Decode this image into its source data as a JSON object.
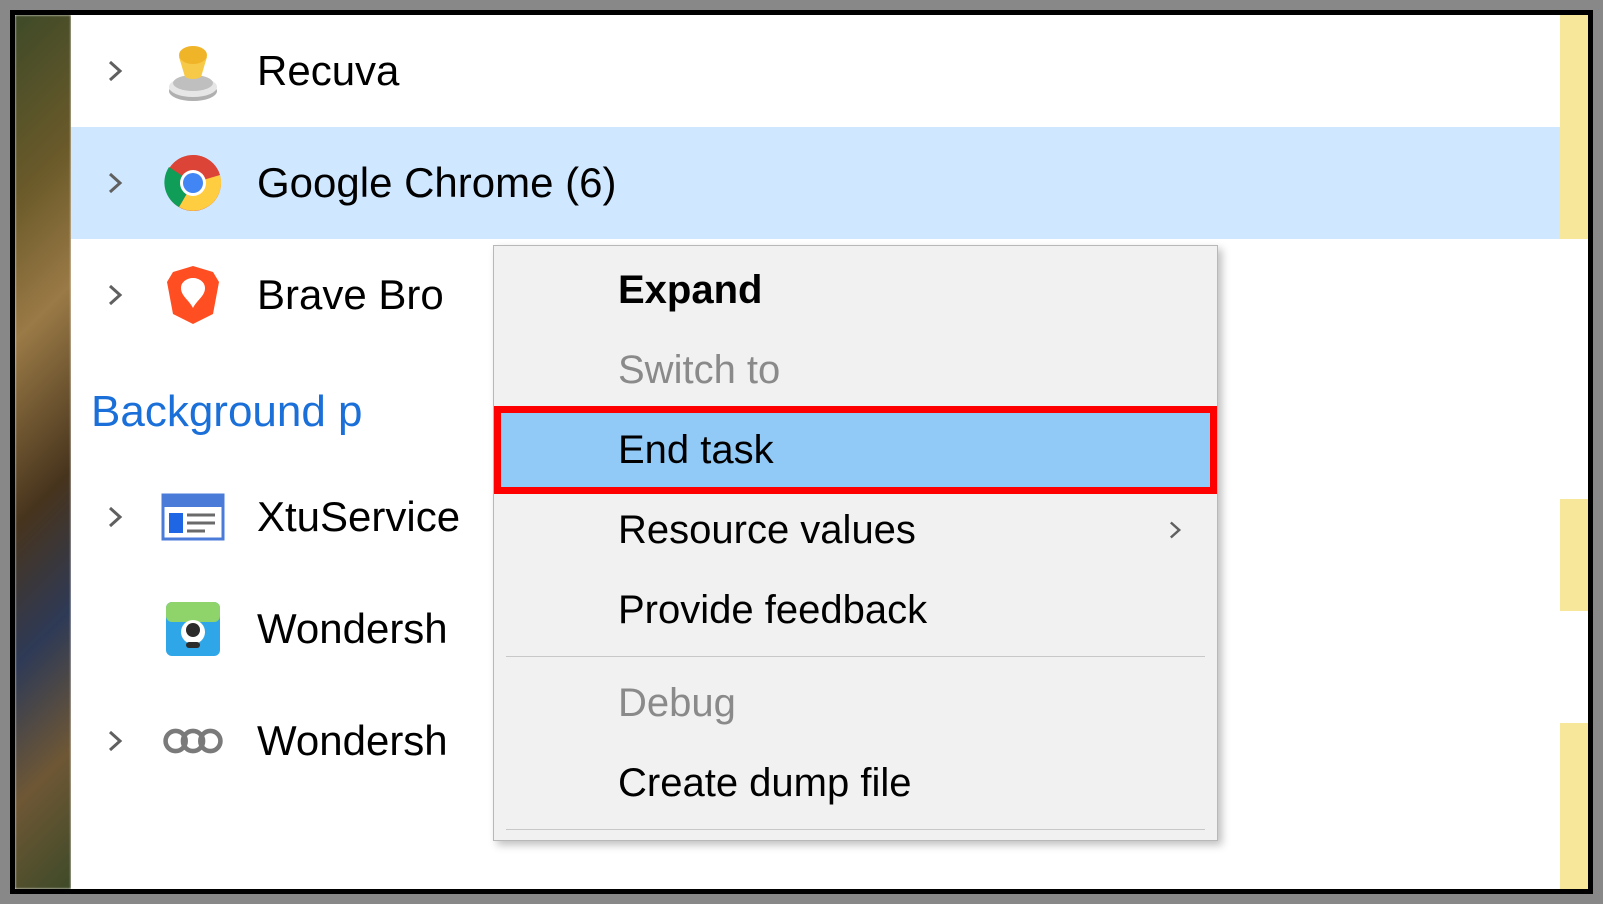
{
  "processes": {
    "recuva": {
      "label": "Recuva"
    },
    "chrome": {
      "label": "Google Chrome (6)"
    },
    "brave": {
      "label": "Brave Bro"
    },
    "xtuservice": {
      "label": "XtuService"
    },
    "wondershare1": {
      "label": "Wondersh"
    },
    "wondershare2": {
      "label": "Wondersh"
    }
  },
  "section": {
    "background_label": "Background p"
  },
  "context_menu": {
    "expand": "Expand",
    "switch_to": "Switch to",
    "end_task": "End task",
    "resource_values": "Resource values",
    "provide_feedback": "Provide feedback",
    "debug": "Debug",
    "create_dump": "Create dump file"
  }
}
